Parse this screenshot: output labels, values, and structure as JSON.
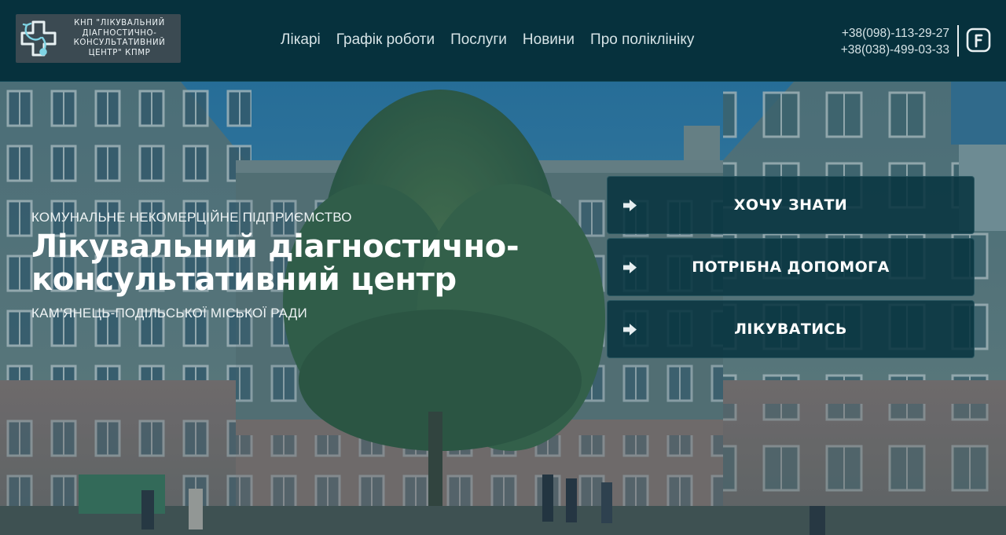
{
  "header": {
    "logo_lines": [
      "КНП \"ЛІКУВАЛЬНИЙ",
      "ДІАГНОСТИЧНО-",
      "КОНСУЛЬТАТИВНИЙ",
      "ЦЕНТР\" КПМР"
    ],
    "logo_icon": "stethoscope-cross-icon",
    "nav": [
      {
        "label": "Лікарі"
      },
      {
        "label": "Графік роботи"
      },
      {
        "label": "Послуги"
      },
      {
        "label": "Новини"
      },
      {
        "label": "Про поліклініку"
      }
    ],
    "phones": [
      "+38(098)-113-29-27",
      "+38(038)-499-03-33"
    ],
    "social_icon": "facebook-icon"
  },
  "hero": {
    "background": "hospital-building-photo",
    "eyebrow": "КОМУНАЛЬНЕ НЕКОМЕРЦІЙНЕ ПІДПРИЄМСТВО",
    "title_lines": [
      "Лікувальний діагностично-",
      "консультативний центр"
    ],
    "subtitle": "КАМ’ЯНЕЦЬ-ПОДІЛЬСЬКОЇ МІСЬКОЇ РАДИ",
    "cta": [
      {
        "label": "ХОЧУ ЗНАТИ",
        "icon": "arrow-right-icon"
      },
      {
        "label": "ПОТРІБНА ДОПОМОГА",
        "icon": "arrow-right-icon"
      },
      {
        "label": "ЛІКУВАТИСЬ",
        "icon": "arrow-right-icon"
      }
    ]
  },
  "colors": {
    "header_bg": "#06313d",
    "cta_bg": "#083440",
    "text_light": "#d6e3e6",
    "overlay": "#083442"
  }
}
